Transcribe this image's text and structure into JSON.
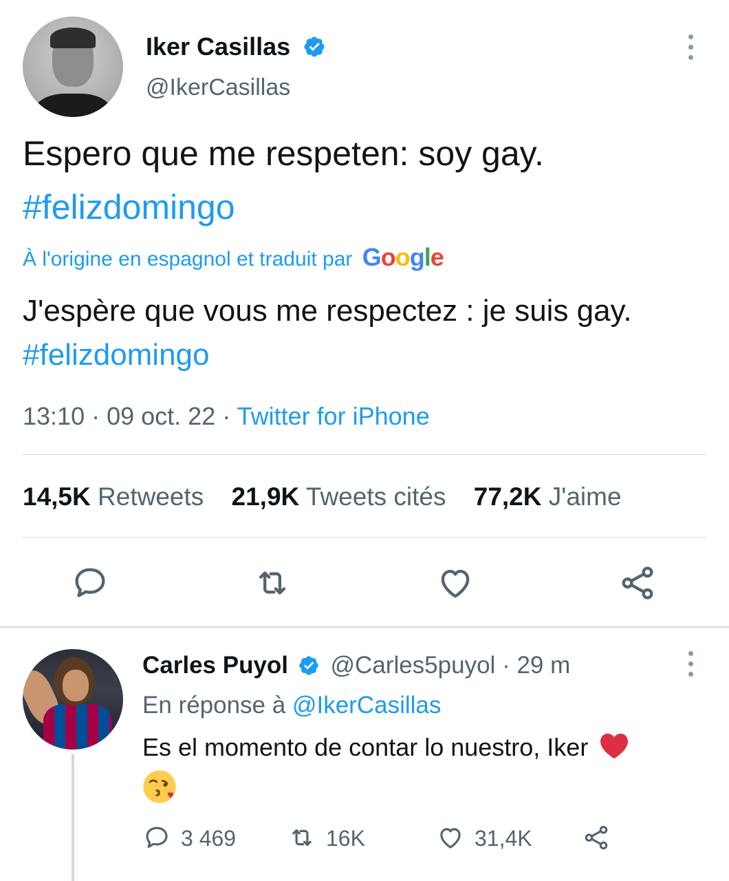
{
  "tweet": {
    "author_name": "Iker Casillas",
    "author_handle": "@IkerCasillas",
    "text_line1": "Espero que me respeten: soy gay.",
    "hashtag": "#felizdomingo",
    "translation_label": "À l'origine en espagnol et traduit par",
    "translation_provider": "Google",
    "translated_text_line1": "J'espère que vous me respectez : je suis gay.",
    "translated_hashtag": "#felizdomingo",
    "time": "13:10",
    "date": "09 oct. 22",
    "source": "Twitter for iPhone",
    "stats": {
      "retweets_count": "14,5K",
      "retweets_label": "Retweets",
      "quotes_count": "21,9K",
      "quotes_label": "Tweets cités",
      "likes_count": "77,2K",
      "likes_label": "J'aime"
    }
  },
  "reply": {
    "author_name": "Carles Puyol",
    "author_handle": "@Carles5puyol",
    "age": "29 m",
    "replying_prefix": "En réponse à",
    "replying_to": "@IkerCasillas",
    "text": "Es el momento de contar lo nuestro, Iker",
    "emoji_1": "red-heart",
    "emoji_2": "face-blowing-a-kiss",
    "reply_count": "3 469",
    "retweet_count": "16K",
    "like_count": "31,4K"
  },
  "colors": {
    "accent": "#1d9bf0",
    "secondary_text": "#536471",
    "divider": "#cfd9de"
  },
  "icons": [
    "verified-badge-icon",
    "more-options-icon",
    "reply-icon",
    "retweet-icon",
    "like-icon",
    "share-icon"
  ]
}
